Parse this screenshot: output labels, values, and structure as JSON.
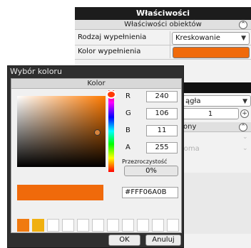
{
  "properties": {
    "title": "Właściwości",
    "section_objects": "Właściwości obiektów",
    "fill_type_label": "Rodzaj wypełnienia",
    "fill_type_value": "Kreskowanie",
    "fill_color_label": "Kolor wypełnienia",
    "fill_color_value": "#F06A0B",
    "partial_select": "ągła",
    "stepper_value": "1",
    "partial_section": "ony",
    "faded_text": "ioma"
  },
  "color_picker": {
    "title": "Wybór koloru",
    "header": "Kolor",
    "r_label": "R",
    "r_value": "240",
    "g_label": "G",
    "g_value": "106",
    "b_label": "B",
    "b_value": "11",
    "a_label": "A",
    "a_value": "255",
    "transparency_label": "Przezroczystość",
    "transparency_value": "0%",
    "hex_value": "#FFF06A0B",
    "recent_swatches": [
      "#F07A10",
      "#F0B010",
      "#FFFFFF",
      "#FFFFFF",
      "#FFFFFF",
      "#FFFFFF",
      "#FFFFFF",
      "#FFFFFF",
      "#FFFFFF",
      "#FFFFFF",
      "#FFFFFF",
      "#FFFFFF"
    ],
    "ok_label": "OK",
    "cancel_label": "Anuluj"
  },
  "icons": {
    "collapse": "chevron-up-icon",
    "dropdown": "chevron-down-icon",
    "add": "plus-icon"
  }
}
